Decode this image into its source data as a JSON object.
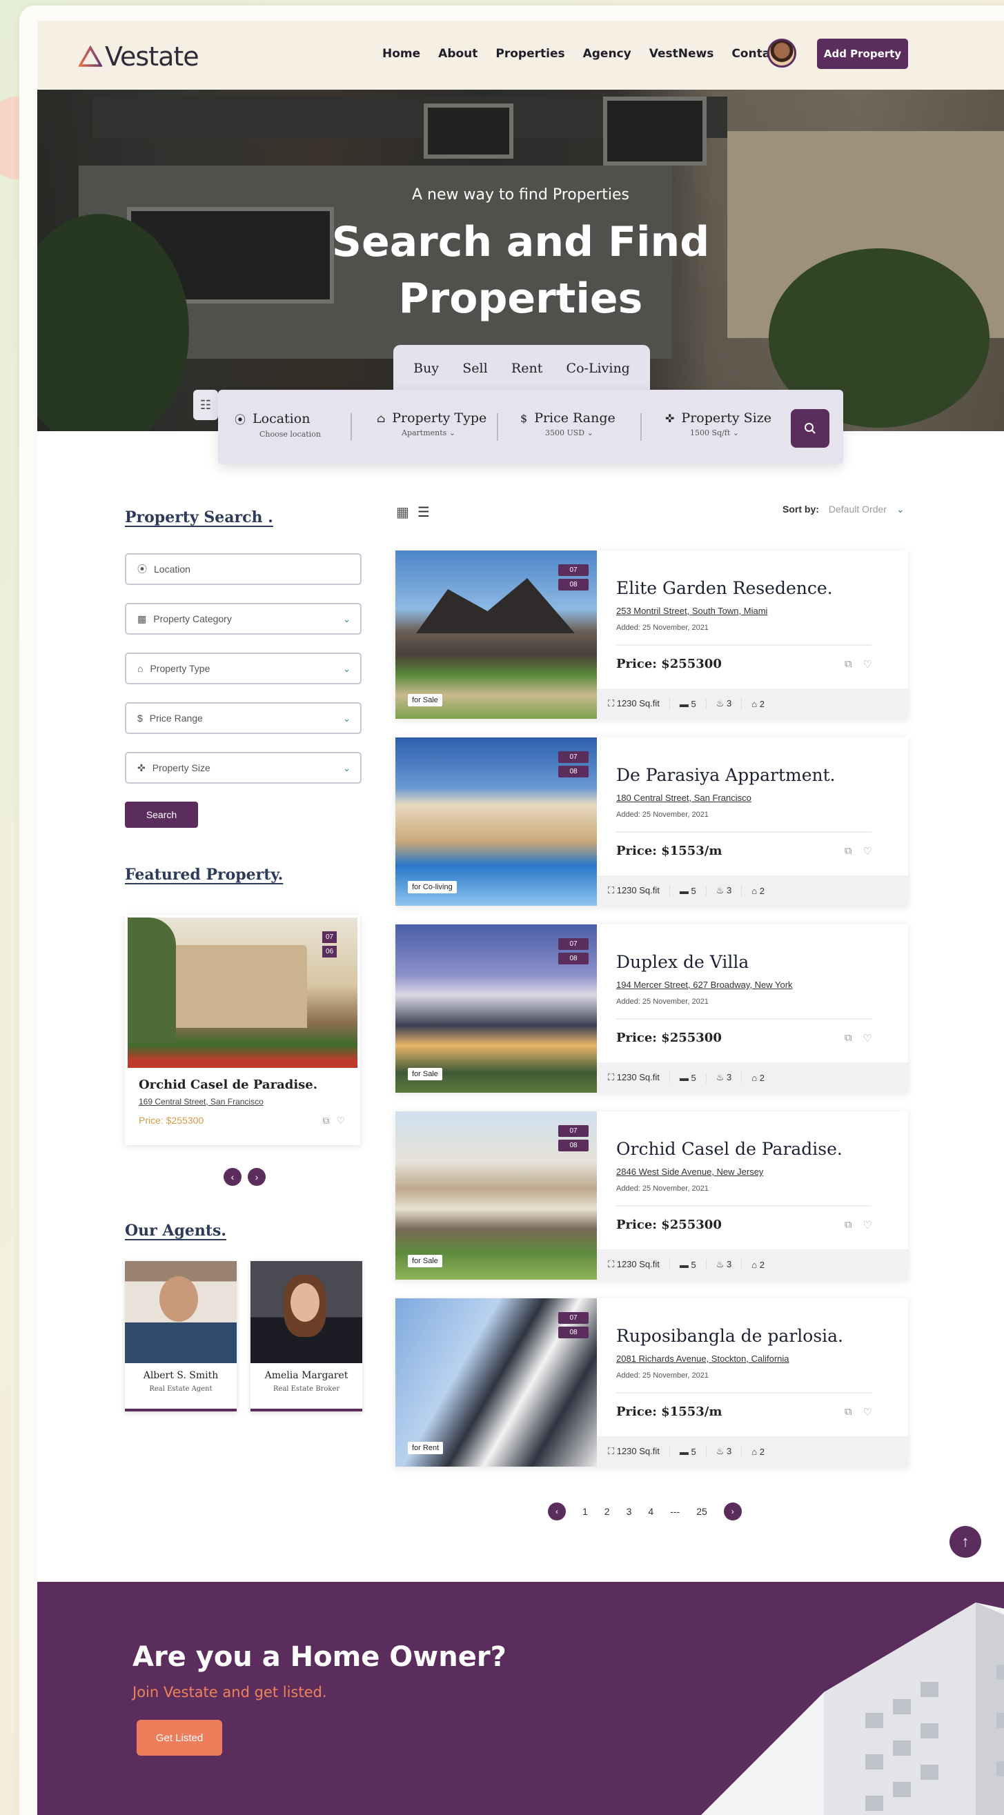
{
  "brand": {
    "name": "Vestate"
  },
  "nav": [
    "Home",
    "About",
    "Properties",
    "Agency",
    "VestNews",
    "Contact"
  ],
  "header": {
    "add_property": "Add Property"
  },
  "hero": {
    "subtitle": "A new way to find Properties",
    "title_line1": "Search and Find",
    "title_line2": "Properties",
    "tabs": [
      "Buy",
      "Sell",
      "Rent",
      "Co-Living"
    ],
    "active_tab": "Buy",
    "search": [
      {
        "label": "Location",
        "sub": "Choose location",
        "icon": "pin-icon"
      },
      {
        "label": "Property Type",
        "sub": "Apartments",
        "icon": "house-icon"
      },
      {
        "label": "Price Range",
        "sub": "3500 USD",
        "icon": "dollar-icon"
      },
      {
        "label": "Property Size",
        "sub": "1500 Sq/ft",
        "icon": "size-icon"
      }
    ]
  },
  "sidebar": {
    "search_title": "Property Search .",
    "fields": [
      "Location",
      "Property Category",
      "Property Type",
      "Price Range",
      "Property Size"
    ],
    "search_button": "Search",
    "featured_title": "Featured Property.",
    "featured": {
      "title": "Orchid Casel de Paradise.",
      "address": "169 Central Street, San Francisco",
      "price": "Price: $255300",
      "badges": [
        "07",
        "06"
      ]
    },
    "agents_title": "Our Agents.",
    "agents": [
      {
        "name": "Albert S. Smith",
        "role": "Real Estate Agent"
      },
      {
        "name": "Amelia Margaret",
        "role": "Real Estate Broker"
      }
    ]
  },
  "listing": {
    "sort_label": "Sort by:",
    "sort_value": "Default Order",
    "properties": [
      {
        "title": "Elite Garden Resedence.",
        "address": "253 Montril Street, South Town, Miami",
        "added": "Added: 25 November, 2021",
        "price": "Price: $255300",
        "tag": "for Sale",
        "beds_badge": "07",
        "baths_badge": "08",
        "area": "1230 Sq.fit",
        "beds": "5",
        "baths": "3",
        "garage": "2"
      },
      {
        "title": "De Parasiya Appartment.",
        "address": "180 Central Street, San Francisco",
        "added": "Added: 25 November, 2021",
        "price": "Price: $1553/m",
        "tag": "for Co-living",
        "beds_badge": "07",
        "baths_badge": "08",
        "area": "1230 Sq.fit",
        "beds": "5",
        "baths": "3",
        "garage": "2"
      },
      {
        "title": "Duplex de Villa",
        "address": "194 Mercer Street, 627 Broadway, New York",
        "added": "Added: 25 November, 2021",
        "price": "Price: $255300",
        "tag": "for Sale",
        "beds_badge": "07",
        "baths_badge": "08",
        "area": "1230 Sq.fit",
        "beds": "5",
        "baths": "3",
        "garage": "2"
      },
      {
        "title": "Orchid Casel de Paradise.",
        "address": "2846 West Side Avenue, New Jersey",
        "added": "Added: 25 November, 2021",
        "price": "Price: $255300",
        "tag": "for Sale",
        "beds_badge": "07",
        "baths_badge": "08",
        "area": "1230 Sq.fit",
        "beds": "5",
        "baths": "3",
        "garage": "2"
      },
      {
        "title": "Ruposibangla de parlosia.",
        "address": "2081 Richards Avenue, Stockton, California",
        "added": "Added: 25 November, 2021",
        "price": "Price: $1553/m",
        "tag": "for Rent",
        "beds_badge": "07",
        "baths_badge": "08",
        "area": "1230 Sq.fit",
        "beds": "5",
        "baths": "3",
        "garage": "2"
      }
    ],
    "pagination": [
      "1",
      "2",
      "3",
      "4",
      "25"
    ],
    "ellipsis": "---"
  },
  "cta": {
    "title": "Are you a Home Owner?",
    "subtitle": "Join Vestate and get listed.",
    "button": "Get Listed"
  },
  "colors": {
    "brand": "#5a2d5d",
    "accent": "#ee7d5c",
    "header_bg": "#f5efe4"
  }
}
